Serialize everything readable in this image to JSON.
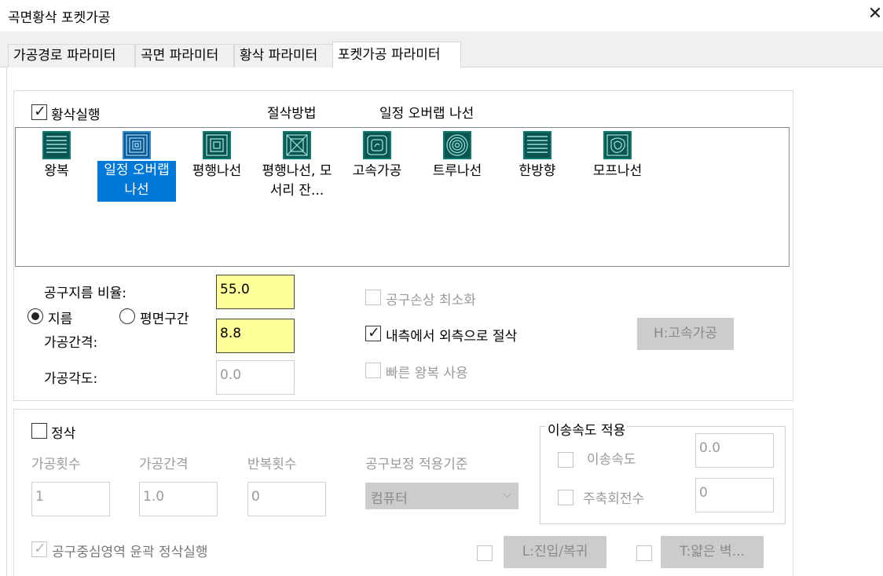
{
  "window": {
    "title": "곡면황삭 포켓가공",
    "close_glyph": "✕"
  },
  "tabs": [
    {
      "label": "가공경로 파라미터"
    },
    {
      "label": "곡면 파라미터"
    },
    {
      "label": "황삭 파라미터"
    },
    {
      "label": "포켓가공 파라미터",
      "active": true
    }
  ],
  "roughing": {
    "enable_label": "황삭실행",
    "enabled": true,
    "method_header": "절삭방법",
    "method_value": "일정 오버랩 나선",
    "methods": [
      {
        "label": "왕복",
        "icon": "zigzag-icon"
      },
      {
        "label": "일정 오버랩 나선",
        "icon": "constant-overlap-spiral-icon",
        "selected": true
      },
      {
        "label": "평행나선",
        "icon": "parallel-spiral-icon"
      },
      {
        "label": "평행나선, 모서리 잔...",
        "icon": "parallel-spiral-corner-icon"
      },
      {
        "label": "고속가공",
        "icon": "high-speed-icon"
      },
      {
        "label": "트루나선",
        "icon": "true-spiral-icon"
      },
      {
        "label": "한방향",
        "icon": "one-way-icon"
      },
      {
        "label": "모프나선",
        "icon": "morph-spiral-icon"
      }
    ],
    "tool_diameter_ratio_label": "공구지름 비율:",
    "tool_diameter_ratio_value": "55.0",
    "radio_diameter_label": "지름",
    "radio_flat_label": "평면구간",
    "radio_selected": "지름",
    "stepover_label": "가공간격:",
    "stepover_value": "8.8",
    "angle_label": "가공각도:",
    "angle_value": "0.0",
    "minimize_tool_burial_label": "공구손상 최소화",
    "minimize_tool_burial_checked": false,
    "inside_out_label": "내측에서 외측으로 절삭",
    "inside_out_checked": true,
    "fast_zigzag_label": "빠른 왕복 사용",
    "fast_zigzag_checked": false,
    "high_speed_button": "H:고속가공"
  },
  "finish": {
    "enable_label": "정삭",
    "enabled": false,
    "passes_label": "가공횟수",
    "passes_value": "1",
    "spacing_label": "가공간격",
    "spacing_value": "1.0",
    "repeat_label": "반복횟수",
    "repeat_value": "0",
    "comp_label": "공구보정 적용기준",
    "comp_value": "컴퓨터",
    "contour_label": "공구중심영역 윤곽 정삭실행",
    "contour_checked": true,
    "leadin_button": "L:진입/복귀",
    "thinwall_button": "T:얇은 벽...",
    "feed_group_title": "이송속도 적용",
    "feedrate_label": "이송속도",
    "feedrate_value": "0.0",
    "spindle_label": "주축회전수",
    "spindle_value": "0"
  }
}
